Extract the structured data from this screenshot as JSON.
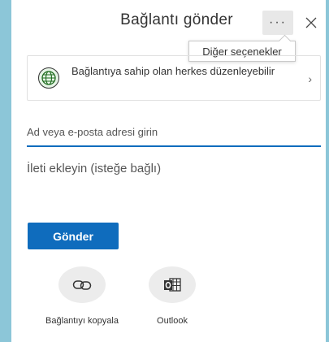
{
  "dialog": {
    "title": "Bağlantı gönder",
    "more_label": "···",
    "more_tooltip": "Diğer seçenekler"
  },
  "permission": {
    "text": "Bağlantıya sahip olan herkes düzenleyebilir",
    "chevron": "›"
  },
  "recipient": {
    "placeholder": "Ad veya e-posta adresi girin",
    "value": ""
  },
  "message": {
    "placeholder": "İleti ekleyin (isteğe bağlı)",
    "value": ""
  },
  "send": {
    "label": "Gönder"
  },
  "share_options": [
    {
      "label": "Bağlantıyı kopyala",
      "icon": "link-icon"
    },
    {
      "label": "Outlook",
      "icon": "outlook-icon"
    }
  ],
  "colors": {
    "accent": "#0f6cbd",
    "backdrop": "#8cc6d8"
  }
}
